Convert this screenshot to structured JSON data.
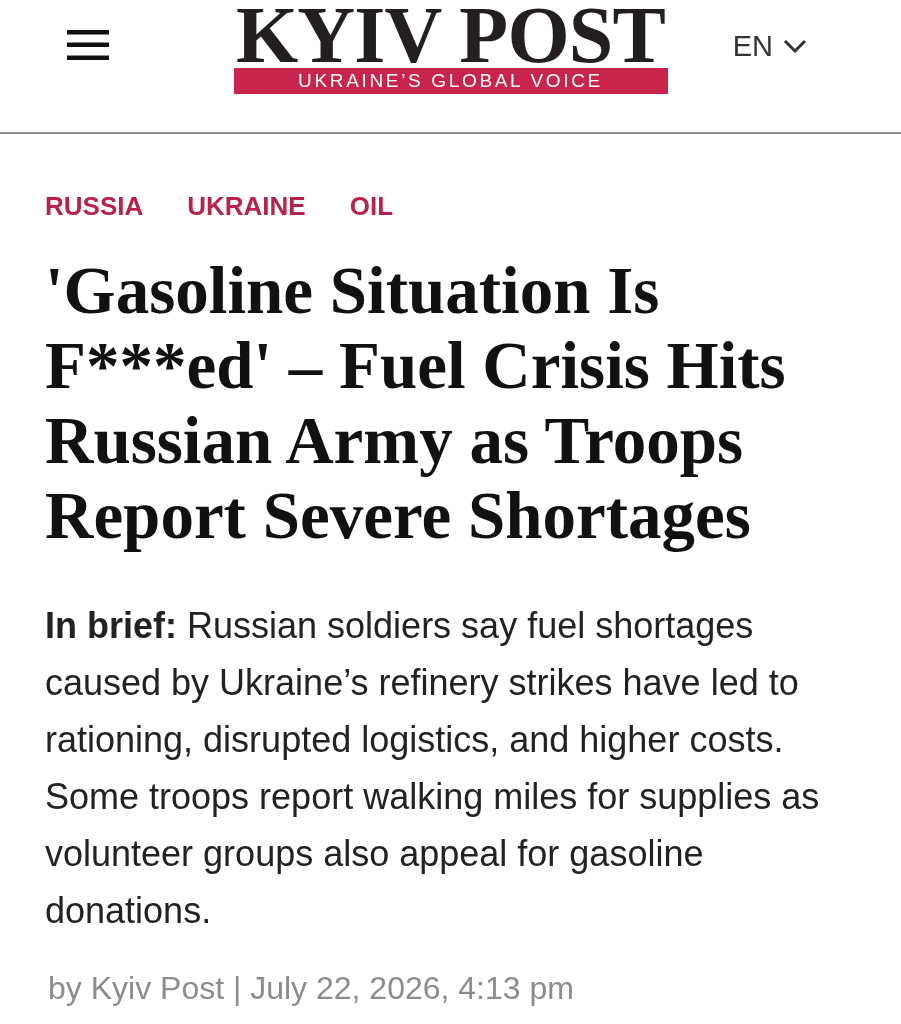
{
  "header": {
    "logo": {
      "wordmark": "KYIV POST",
      "tagline": "UKRAINE’S GLOBAL VOICE"
    },
    "language": {
      "label": "EN"
    }
  },
  "article": {
    "tags": [
      "RUSSIA",
      "UKRAINE",
      "OIL"
    ],
    "headline": "'Gasoline Situation Is F***ed' – Fuel Crisis Hits Russian Army as Troops Report Severe Shortages",
    "brief": "**In brief:** Russian soldiers say fuel shortages caused by Ukraine’s refinery strikes have led to rationing, disrupted logistics, and higher costs. Some troops report walking miles for supplies as volunteer groups also appeal for gasoline donations.",
    "byline": "by Kyiv Post | July 22, 2026, 4:13 pm"
  }
}
